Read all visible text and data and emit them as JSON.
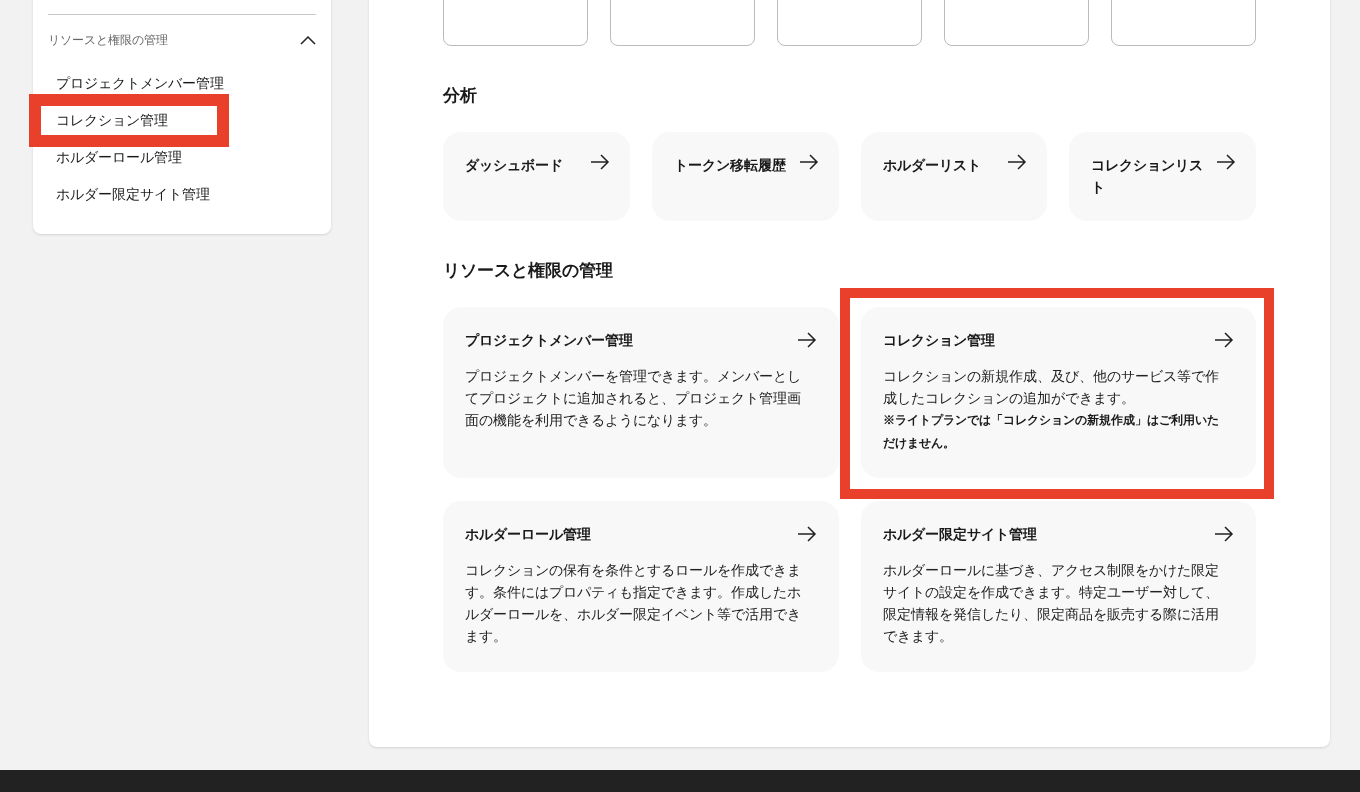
{
  "sidebar": {
    "section": {
      "title": "リソースと権限の管理",
      "expanded": true
    },
    "items": [
      {
        "label": "プロジェクトメンバー管理",
        "highlighted": false
      },
      {
        "label": "コレクション管理",
        "highlighted": true
      },
      {
        "label": "ホルダーロール管理",
        "highlighted": false
      },
      {
        "label": "ホルダー限定サイト管理",
        "highlighted": false
      }
    ]
  },
  "sections": [
    {
      "title": "分析",
      "kind": "links",
      "cards": [
        {
          "title": "ダッシュボード",
          "highlighted": false
        },
        {
          "title": "トークン移転履歴",
          "highlighted": false
        },
        {
          "title": "ホルダーリスト",
          "highlighted": false
        },
        {
          "title": "コレクションリスト",
          "highlighted": false
        }
      ]
    },
    {
      "title": "リソースと権限の管理",
      "kind": "details",
      "cards": [
        {
          "title": "プロジェクトメンバー管理",
          "description": "プロジェクトメンバーを管理できます。メンバーとしてプロジェクトに追加されると、プロジェクト管理画面の機能を利用できるようになります。",
          "highlighted": false
        },
        {
          "title": "コレクション管理",
          "description": "コレクションの新規作成、及び、他のサービス等で作成したコレクションの追加ができます。",
          "note": "※ライトプランでは「コレクションの新規作成」はご利用いただけません。",
          "highlighted": true
        },
        {
          "title": "ホルダーロール管理",
          "description": "コレクションの保有を条件とするロールを作成できます。条件にはプロパティも指定できます。作成したホルダーロールを、ホルダー限定イベント等で活用できます。",
          "highlighted": false
        },
        {
          "title": "ホルダー限定サイト管理",
          "description": "ホルダーロールに基づき、アクセス制限をかけた限定サイトの設定を作成できます。特定ユーザー対して、限定情報を発信したり、限定商品を販売する際に活用できます。",
          "highlighted": false
        }
      ]
    }
  ]
}
